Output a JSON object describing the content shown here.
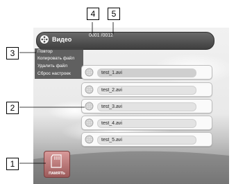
{
  "header": {
    "title": "Видео",
    "counter": "0001 /0012"
  },
  "menu": {
    "items": [
      "Повтор",
      "Копировать файл",
      "Удалить файл",
      "Сброс настроек"
    ]
  },
  "files": [
    {
      "name": "test_1.avi",
      "selected": true
    },
    {
      "name": "test_2.avi",
      "selected": false
    },
    {
      "name": "test_3.avi",
      "selected": false
    },
    {
      "name": "test_4.avi",
      "selected": false
    },
    {
      "name": "test_5.avi",
      "selected": false
    }
  ],
  "memory_button": {
    "label": "ПАМЯТЬ",
    "icon": "memory-card-icon"
  },
  "callouts": [
    "1",
    "2",
    "3",
    "4",
    "5"
  ],
  "colors": {
    "title_bar": "#4a4a4a",
    "menu_bg": "#464646",
    "memory_button": "#c07a7a"
  }
}
